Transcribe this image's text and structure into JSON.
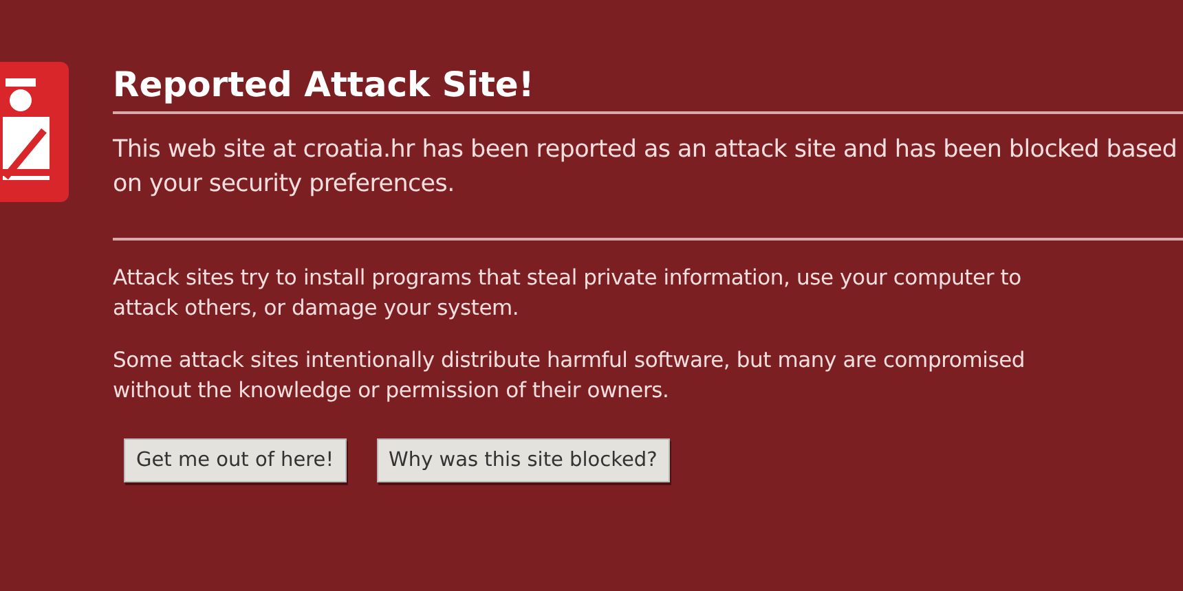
{
  "title": "Reported Attack Site!",
  "intro": "This web site at croatia.hr has been reported as an attack site and has been blocked based on your security preferences.",
  "paragraphs": [
    "Attack sites try to install programs that steal private information, use your computer to attack others, or damage your system.",
    "Some attack sites intentionally distribute harmful software, but many are compromised without the knowledge or permission of their owners."
  ],
  "buttons": [
    "Get me out of here!",
    "Why was this site blocked?"
  ]
}
